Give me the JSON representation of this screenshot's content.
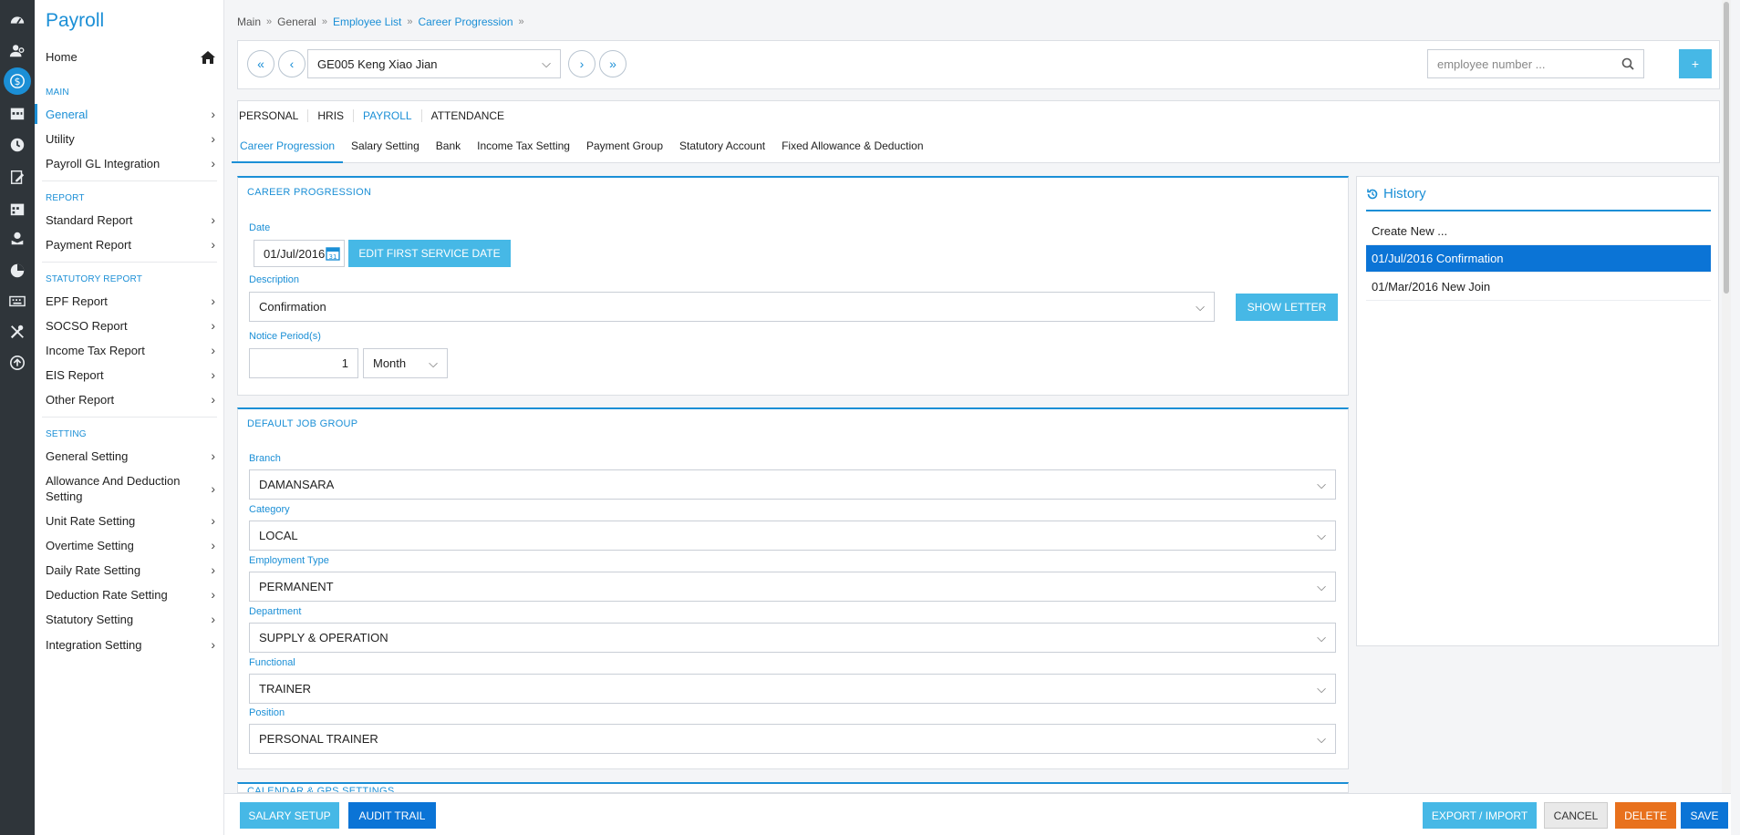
{
  "app": {
    "title": "Payroll"
  },
  "colors": {
    "accent": "#1b8fd6",
    "rail": "#2f353a",
    "info_button": "#46b8e6",
    "selected": "#0b74d6",
    "delete": "#e8711d",
    "save": "#0b74d6",
    "audit": "#0b74d6"
  },
  "rail_icons": [
    "dashboard-icon",
    "users-settings-icon",
    "payroll-dollar-icon",
    "calendar-icon",
    "clock-icon",
    "document-edit-icon",
    "calendar-grid-icon",
    "hand-coin-icon",
    "pie-chart-icon",
    "keyboard-icon",
    "tools-icon",
    "upload-icon"
  ],
  "sidebar": {
    "home_label": "Home",
    "sections": {
      "main": "MAIN",
      "report": "REPORT",
      "statutory": "STATUTORY REPORT",
      "setting": "SETTING"
    },
    "main_items": [
      "General",
      "Utility",
      "Payroll GL Integration"
    ],
    "report_items": [
      "Standard Report",
      "Payment Report"
    ],
    "statutory_items": [
      "EPF Report",
      "SOCSO Report",
      "Income Tax Report",
      "EIS Report",
      "Other Report"
    ],
    "setting_items": [
      "General Setting",
      "Allowance And Deduction Setting",
      "Unit Rate Setting",
      "Overtime Setting",
      "Daily Rate Setting",
      "Deduction Rate Setting",
      "Statutory Setting",
      "Integration Setting"
    ]
  },
  "breadcrumb": [
    "Main",
    "General",
    "Employee List",
    "Career Progression"
  ],
  "employee": {
    "selected": "GE005 Keng Xiao Jian",
    "search_placeholder": "employee number ...",
    "add_label": "+"
  },
  "module_tabs": [
    "PERSONAL",
    "HRIS",
    "PAYROLL",
    "ATTENDANCE"
  ],
  "sub_tabs": [
    "Career Progression",
    "Salary Setting",
    "Bank",
    "Income Tax Setting",
    "Payment Group",
    "Statutory Account",
    "Fixed Allowance & Deduction"
  ],
  "career": {
    "title": "CAREER PROGRESSION",
    "date_label": "Date",
    "date_value": "01/Jul/2016",
    "edit_first_service_label": "EDIT FIRST SERVICE DATE",
    "description_label": "Description",
    "description_value": "Confirmation",
    "show_letter_label": "SHOW LETTER",
    "notice_label": "Notice Period(s)",
    "notice_value": "1",
    "notice_unit": "Month"
  },
  "job_group": {
    "title": "DEFAULT JOB GROUP",
    "branch_label": "Branch",
    "branch_value": "DAMANSARA",
    "category_label": "Category",
    "category_value": "LOCAL",
    "employment_label": "Employment Type",
    "employment_value": "PERMANENT",
    "department_label": "Department",
    "department_value": "SUPPLY & OPERATION",
    "functional_label": "Functional",
    "functional_value": "TRAINER",
    "position_label": "Position",
    "position_value": "PERSONAL TRAINER"
  },
  "next_section_title": "CALENDAR & GPS SETTINGS",
  "history": {
    "title": "History",
    "items": [
      "Create New ...",
      "01/Jul/2016 Confirmation",
      "01/Mar/2016 New Join"
    ]
  },
  "footer": {
    "salary_setup": "SALARY SETUP",
    "audit_trail": "AUDIT TRAIL",
    "export_import": "EXPORT / IMPORT",
    "cancel": "CANCEL",
    "delete": "DELETE",
    "save": "SAVE"
  }
}
